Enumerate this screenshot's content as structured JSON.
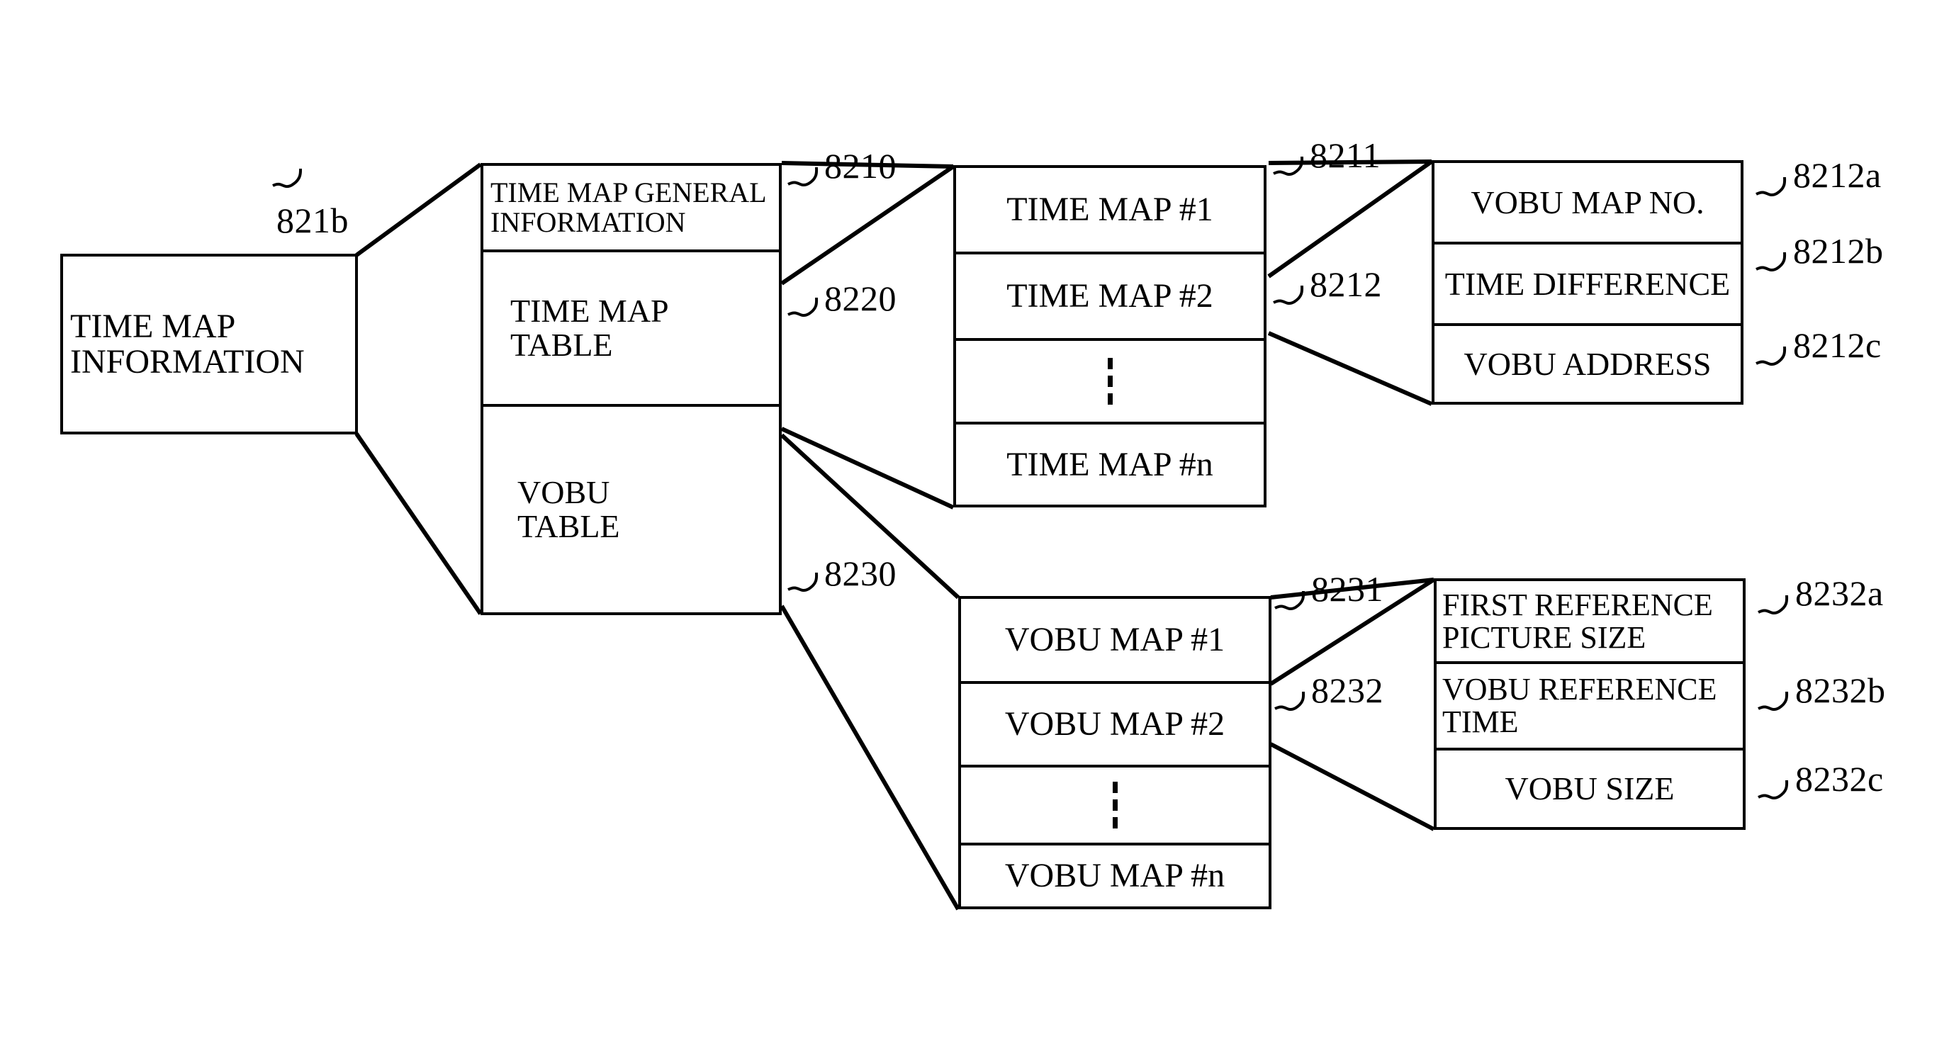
{
  "figure": {
    "type": "patent-block-diagram",
    "title": "Time map information data structure"
  },
  "boxes": {
    "time_map_information": {
      "ref": "821b",
      "cells": [
        {
          "line1": "TIME MAP",
          "line2": "INFORMATION"
        }
      ]
    },
    "time_map_info_detail": {
      "cells": [
        {
          "label": "TIME MAP GENERAL INFORMATION",
          "ref": "8210"
        },
        {
          "label": "TIME MAP TABLE",
          "ref": "8220"
        },
        {
          "label": "VOBU TABLE",
          "ref": "8230"
        }
      ]
    },
    "time_map_table_detail": {
      "cells": [
        {
          "label": "TIME MAP #1",
          "ref": "8211"
        },
        {
          "label": "TIME MAP #2",
          "ref": "8212"
        },
        {
          "label": "⋮",
          "ref": ""
        },
        {
          "label": "TIME MAP #n",
          "ref": ""
        }
      ]
    },
    "time_map_entry_detail": {
      "cells": [
        {
          "label": "VOBU MAP NO.",
          "ref": "8212a"
        },
        {
          "label": "TIME DIFFERENCE",
          "ref": "8212b"
        },
        {
          "label": "VOBU ADDRESS",
          "ref": "8212c"
        }
      ]
    },
    "vobu_table_detail": {
      "cells": [
        {
          "label": "VOBU MAP #1",
          "ref": "8231"
        },
        {
          "label": "VOBU MAP #2",
          "ref": "8232"
        },
        {
          "label": "⋮",
          "ref": ""
        },
        {
          "label": "VOBU MAP #n",
          "ref": ""
        }
      ]
    },
    "vobu_map_entry_detail": {
      "cells": [
        {
          "line1": "FIRST REFERENCE",
          "line2": "PICTURE SIZE",
          "ref": "8232a"
        },
        {
          "line1": "VOBU REFERENCE",
          "line2": "TIME",
          "ref": "8232b"
        },
        {
          "line1": "VOBU SIZE",
          "line2": "",
          "ref": "8232c"
        }
      ]
    }
  },
  "refs": {
    "r821b": "821b",
    "r8210": "8210",
    "r8220": "8220",
    "r8230": "8230",
    "r8211": "8211",
    "r8212": "8212",
    "r8231": "8231",
    "r8232": "8232",
    "r8212a": "8212a",
    "r8212b": "8212b",
    "r8212c": "8212c",
    "r8232a": "8232a",
    "r8232b": "8232b",
    "r8232c": "8232c"
  },
  "colors": {
    "ink": "#000000",
    "paper": "#ffffff"
  }
}
